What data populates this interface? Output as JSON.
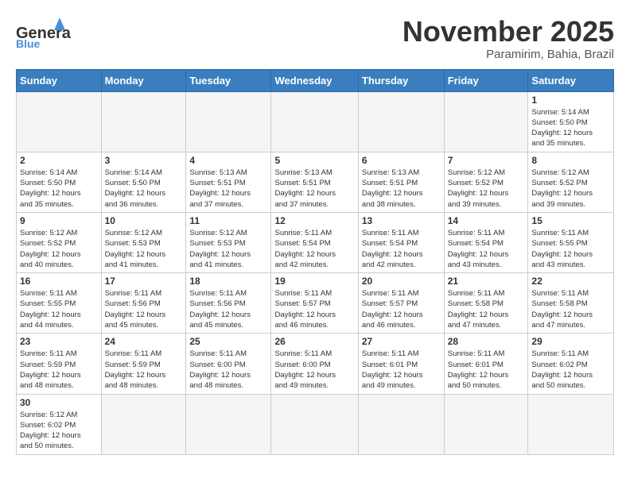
{
  "header": {
    "logo_general": "General",
    "logo_blue": "Blue",
    "month_title": "November 2025",
    "location": "Paramirim, Bahia, Brazil"
  },
  "calendar": {
    "days_of_week": [
      "Sunday",
      "Monday",
      "Tuesday",
      "Wednesday",
      "Thursday",
      "Friday",
      "Saturday"
    ],
    "weeks": [
      [
        {
          "day": "",
          "info": ""
        },
        {
          "day": "",
          "info": ""
        },
        {
          "day": "",
          "info": ""
        },
        {
          "day": "",
          "info": ""
        },
        {
          "day": "",
          "info": ""
        },
        {
          "day": "",
          "info": ""
        },
        {
          "day": "1",
          "info": "Sunrise: 5:14 AM\nSunset: 5:50 PM\nDaylight: 12 hours\nand 35 minutes."
        }
      ],
      [
        {
          "day": "2",
          "info": "Sunrise: 5:14 AM\nSunset: 5:50 PM\nDaylight: 12 hours\nand 35 minutes."
        },
        {
          "day": "3",
          "info": "Sunrise: 5:14 AM\nSunset: 5:50 PM\nDaylight: 12 hours\nand 36 minutes."
        },
        {
          "day": "4",
          "info": "Sunrise: 5:13 AM\nSunset: 5:51 PM\nDaylight: 12 hours\nand 37 minutes."
        },
        {
          "day": "5",
          "info": "Sunrise: 5:13 AM\nSunset: 5:51 PM\nDaylight: 12 hours\nand 37 minutes."
        },
        {
          "day": "6",
          "info": "Sunrise: 5:13 AM\nSunset: 5:51 PM\nDaylight: 12 hours\nand 38 minutes."
        },
        {
          "day": "7",
          "info": "Sunrise: 5:12 AM\nSunset: 5:52 PM\nDaylight: 12 hours\nand 39 minutes."
        },
        {
          "day": "8",
          "info": "Sunrise: 5:12 AM\nSunset: 5:52 PM\nDaylight: 12 hours\nand 39 minutes."
        }
      ],
      [
        {
          "day": "9",
          "info": "Sunrise: 5:12 AM\nSunset: 5:52 PM\nDaylight: 12 hours\nand 40 minutes."
        },
        {
          "day": "10",
          "info": "Sunrise: 5:12 AM\nSunset: 5:53 PM\nDaylight: 12 hours\nand 41 minutes."
        },
        {
          "day": "11",
          "info": "Sunrise: 5:12 AM\nSunset: 5:53 PM\nDaylight: 12 hours\nand 41 minutes."
        },
        {
          "day": "12",
          "info": "Sunrise: 5:11 AM\nSunset: 5:54 PM\nDaylight: 12 hours\nand 42 minutes."
        },
        {
          "day": "13",
          "info": "Sunrise: 5:11 AM\nSunset: 5:54 PM\nDaylight: 12 hours\nand 42 minutes."
        },
        {
          "day": "14",
          "info": "Sunrise: 5:11 AM\nSunset: 5:54 PM\nDaylight: 12 hours\nand 43 minutes."
        },
        {
          "day": "15",
          "info": "Sunrise: 5:11 AM\nSunset: 5:55 PM\nDaylight: 12 hours\nand 43 minutes."
        }
      ],
      [
        {
          "day": "16",
          "info": "Sunrise: 5:11 AM\nSunset: 5:55 PM\nDaylight: 12 hours\nand 44 minutes."
        },
        {
          "day": "17",
          "info": "Sunrise: 5:11 AM\nSunset: 5:56 PM\nDaylight: 12 hours\nand 45 minutes."
        },
        {
          "day": "18",
          "info": "Sunrise: 5:11 AM\nSunset: 5:56 PM\nDaylight: 12 hours\nand 45 minutes."
        },
        {
          "day": "19",
          "info": "Sunrise: 5:11 AM\nSunset: 5:57 PM\nDaylight: 12 hours\nand 46 minutes."
        },
        {
          "day": "20",
          "info": "Sunrise: 5:11 AM\nSunset: 5:57 PM\nDaylight: 12 hours\nand 46 minutes."
        },
        {
          "day": "21",
          "info": "Sunrise: 5:11 AM\nSunset: 5:58 PM\nDaylight: 12 hours\nand 47 minutes."
        },
        {
          "day": "22",
          "info": "Sunrise: 5:11 AM\nSunset: 5:58 PM\nDaylight: 12 hours\nand 47 minutes."
        }
      ],
      [
        {
          "day": "23",
          "info": "Sunrise: 5:11 AM\nSunset: 5:59 PM\nDaylight: 12 hours\nand 48 minutes."
        },
        {
          "day": "24",
          "info": "Sunrise: 5:11 AM\nSunset: 5:59 PM\nDaylight: 12 hours\nand 48 minutes."
        },
        {
          "day": "25",
          "info": "Sunrise: 5:11 AM\nSunset: 6:00 PM\nDaylight: 12 hours\nand 48 minutes."
        },
        {
          "day": "26",
          "info": "Sunrise: 5:11 AM\nSunset: 6:00 PM\nDaylight: 12 hours\nand 49 minutes."
        },
        {
          "day": "27",
          "info": "Sunrise: 5:11 AM\nSunset: 6:01 PM\nDaylight: 12 hours\nand 49 minutes."
        },
        {
          "day": "28",
          "info": "Sunrise: 5:11 AM\nSunset: 6:01 PM\nDaylight: 12 hours\nand 50 minutes."
        },
        {
          "day": "29",
          "info": "Sunrise: 5:11 AM\nSunset: 6:02 PM\nDaylight: 12 hours\nand 50 minutes."
        }
      ],
      [
        {
          "day": "30",
          "info": "Sunrise: 5:12 AM\nSunset: 6:02 PM\nDaylight: 12 hours\nand 50 minutes."
        },
        {
          "day": "",
          "info": ""
        },
        {
          "day": "",
          "info": ""
        },
        {
          "day": "",
          "info": ""
        },
        {
          "day": "",
          "info": ""
        },
        {
          "day": "",
          "info": ""
        },
        {
          "day": "",
          "info": ""
        }
      ]
    ]
  }
}
